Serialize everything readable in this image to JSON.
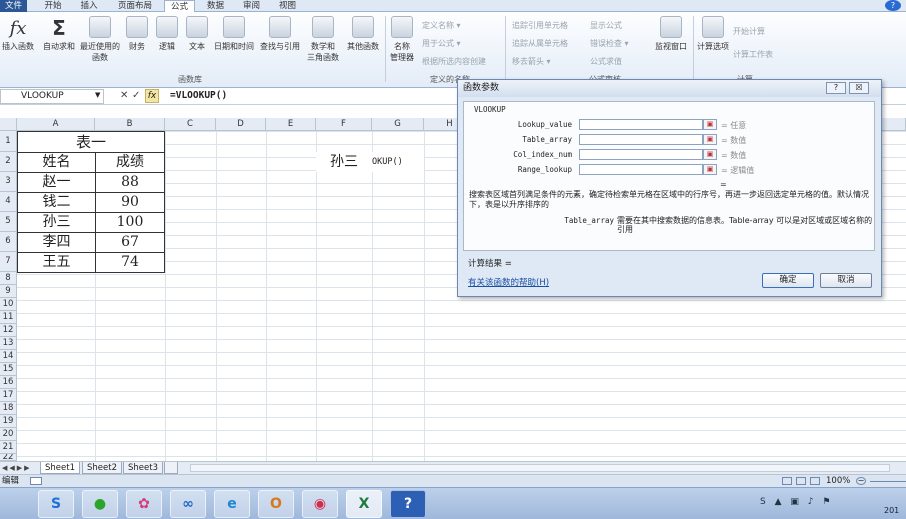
{
  "tabs": [
    "文件",
    "开始",
    "插入",
    "页面布局",
    "公式",
    "数据",
    "审阅",
    "视图"
  ],
  "ribbon": {
    "buttons": [
      {
        "label": "插入函数",
        "icon": "fx-icon"
      },
      {
        "label": "自动求和",
        "icon": "sigma-icon"
      },
      {
        "label": "最近使用的\n函数",
        "icon": "book-icon"
      },
      {
        "label": "财务",
        "icon": "book-icon"
      },
      {
        "label": "逻辑",
        "icon": "book-icon"
      },
      {
        "label": "文本",
        "icon": "text-icon"
      },
      {
        "label": "日期和时间",
        "icon": "book-icon"
      },
      {
        "label": "查找与引用",
        "icon": "book-icon"
      },
      {
        "label": "数学和\n三角函数",
        "icon": "book-icon"
      },
      {
        "label": "其他函数",
        "icon": "book-icon"
      },
      {
        "label": "名称\n管理器",
        "icon": "name-manager-icon"
      }
    ],
    "group_library": "函数库",
    "group_names": "定义的名称",
    "group_audit": "公式审核",
    "group_calc": "计算",
    "names_small": [
      "定义名称 ▾",
      "用于公式 ▾",
      "根据所选内容创建"
    ],
    "audit_small": [
      "追踪引用单元格",
      "追踪从属单元格",
      "移去箭头 ▾",
      "显示公式",
      "错误检查 ▾",
      "公式求值"
    ],
    "watch": "监视窗口",
    "calc_options": "计算选项",
    "calc_small": [
      "开始计算",
      "计算工作表"
    ]
  },
  "formula_bar": {
    "name": "VLOOKUP",
    "formula": "=VLOOKUP()"
  },
  "columns": [
    "A",
    "B",
    "C",
    "D",
    "E",
    "F",
    "G",
    "H"
  ],
  "rows": [
    "1",
    "2",
    "3",
    "4",
    "5",
    "6",
    "7",
    "8",
    "9",
    "10",
    "11",
    "12",
    "13",
    "14",
    "15",
    "16",
    "17",
    "18",
    "19",
    "20",
    "21",
    "22",
    "23",
    "24"
  ],
  "table": {
    "title": "表一",
    "headers": [
      "姓名",
      "成绩"
    ],
    "rows": [
      [
        "赵一",
        "88"
      ],
      [
        "钱二",
        "90"
      ],
      [
        "孙三",
        "100"
      ],
      [
        "李四",
        "67"
      ],
      [
        "王五",
        "74"
      ]
    ]
  },
  "cell_f2": "孙三",
  "cell_g2": "OKUP()",
  "dialog": {
    "title": "函数参数",
    "help_btn": "?",
    "close_btn": "☒",
    "function": "VLOOKUP",
    "args": [
      {
        "name": "Lookup_value",
        "result": "= 任意"
      },
      {
        "name": "Table_array",
        "result": "= 数值"
      },
      {
        "name": "Col_index_num",
        "result": "= 数值"
      },
      {
        "name": "Range_lookup",
        "result": "= 逻辑值"
      }
    ],
    "eq": "=",
    "desc": "搜索表区域首列满足条件的元素，确定待检索单元格在区域中的行序号，再进一步返回选定单元格的值。默认情况下，表是以升序排序的",
    "arg_label": "Table_array",
    "arg_desc": "需要在其中搜索数据的信息表。Table-array 可以是对区域或区域名称的引用",
    "result": "计算结果 =",
    "help_link": "有关该函数的帮助(H)",
    "ok": "确定",
    "cancel": "取消"
  },
  "sheet_tabs": [
    "Sheet1",
    "Sheet2",
    "Sheet3"
  ],
  "status": {
    "mode": "编辑",
    "zoom": "100%"
  },
  "taskbar_year": "201"
}
